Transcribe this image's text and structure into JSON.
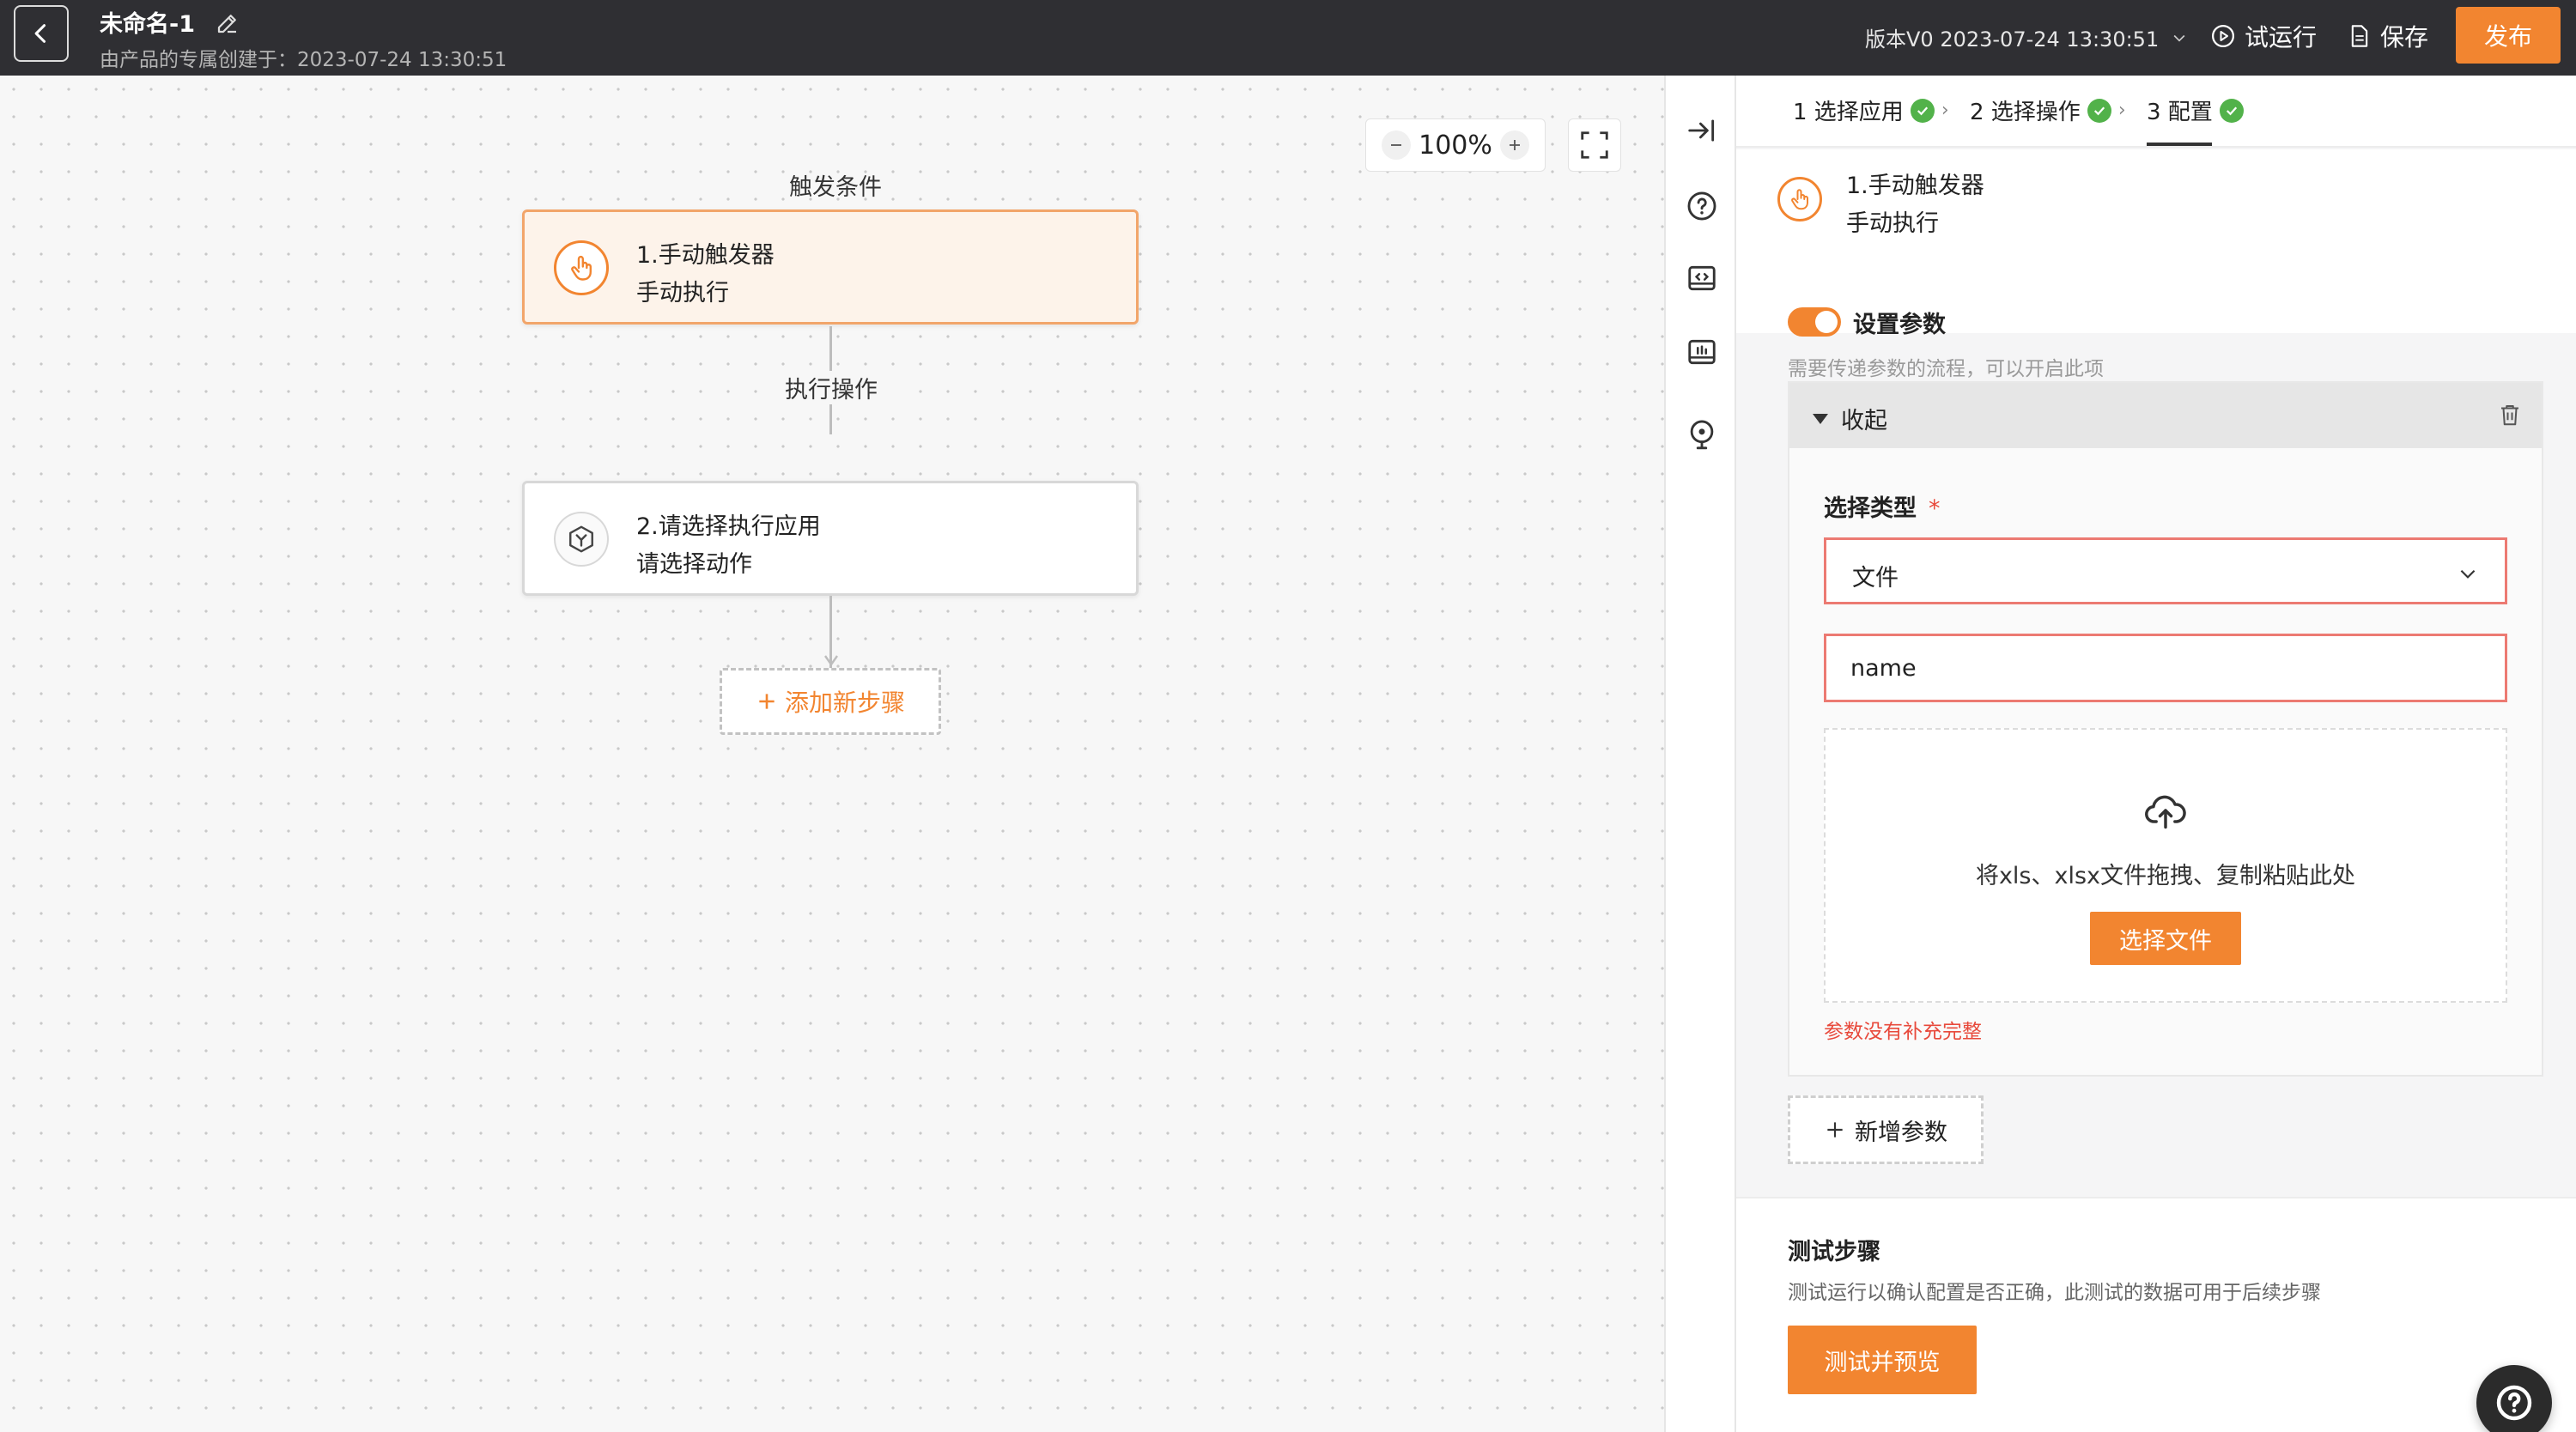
{
  "header": {
    "title": "未命名-1",
    "subtitle": "由产品的专属创建于：2023-07-24 13:30:51",
    "version": "版本V0 2023-07-24 13:30:51",
    "run_label": "试运行",
    "save_label": "保存",
    "publish_label": "发布"
  },
  "canvas": {
    "zoom": "100%",
    "trigger_section_label": "触发条件",
    "action_section_label": "执行操作",
    "nodes": [
      {
        "line1": "1.手动触发器",
        "line2": "手动执行"
      },
      {
        "line1": "2.请选择执行应用",
        "line2": "请选择动作"
      }
    ],
    "add_step_label": "添加新步骤"
  },
  "panel": {
    "steps": [
      {
        "label": "1 选择应用"
      },
      {
        "label": "2 选择操作"
      },
      {
        "label": "3 配置"
      }
    ],
    "trigger": {
      "line1": "1.手动触发器",
      "line2": "手动执行"
    },
    "set_params": {
      "title": "设置参数",
      "hint": "需要传递参数的流程，可以开启此项",
      "enabled": true
    },
    "collapse": {
      "label": "收起",
      "type_label": "选择类型",
      "required_mark": "*",
      "type_value": "文件",
      "name_value": "name",
      "upload_text": "将xls、xlsx文件拖拽、复制粘贴此处",
      "choose_file_label": "选择文件",
      "error": "参数没有补充完整"
    },
    "add_param_label": "新增参数",
    "test": {
      "title": "测试步骤",
      "hint": "测试运行以确认配置是否正确，此测试的数据可用于后续步骤",
      "button_label": "测试并预览"
    }
  },
  "colors": {
    "accent": "#f28530",
    "topbar": "#2f2f33",
    "success": "#52b24a",
    "error": "#e8493b"
  }
}
